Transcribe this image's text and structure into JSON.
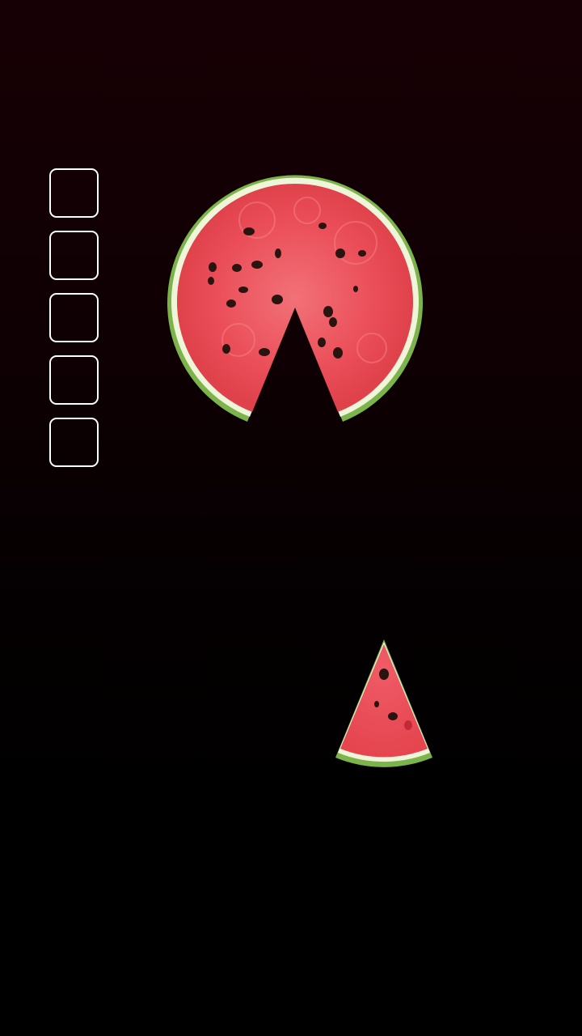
{
  "game": {
    "slot_count": 5,
    "slots": [
      {
        "filled": false
      },
      {
        "filled": false
      },
      {
        "filled": false
      },
      {
        "filled": false
      },
      {
        "filled": false
      }
    ],
    "pieces": [
      {
        "name": "watermelon-round-with-missing-wedge",
        "fill_fraction_missing": 0.11
      },
      {
        "name": "watermelon-wedge-slice"
      }
    ],
    "colors": {
      "background_top": "#170005",
      "background_bottom": "#000000",
      "slot_border": "#ffffff",
      "flesh": "#ec4d57",
      "flesh_light": "#f57a80",
      "rind_inner": "#f6f9e6",
      "rind_outer": "#7bb24a",
      "seed": "#2a1410"
    }
  }
}
